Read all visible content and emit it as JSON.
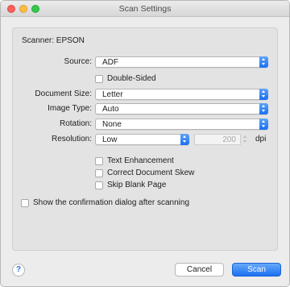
{
  "window": {
    "title": "Scan Settings"
  },
  "scanner": {
    "label": "Scanner: EPSON"
  },
  "source": {
    "label": "Source:",
    "value": "ADF"
  },
  "double_sided": {
    "label": "Double-Sided",
    "checked": false
  },
  "document_size": {
    "label": "Document Size:",
    "value": "Letter"
  },
  "image_type": {
    "label": "Image Type:",
    "value": "Auto"
  },
  "rotation": {
    "label": "Rotation:",
    "value": "None"
  },
  "resolution": {
    "label": "Resolution:",
    "value": "Low",
    "dpi_value": "200",
    "unit": "dpi"
  },
  "options": {
    "text_enhancement": {
      "label": "Text Enhancement",
      "checked": false
    },
    "correct_skew": {
      "label": "Correct Document Skew",
      "checked": false
    },
    "skip_blank": {
      "label": "Skip Blank Page",
      "checked": false
    }
  },
  "confirmation": {
    "label": "Show the confirmation dialog after scanning",
    "checked": false
  },
  "footer": {
    "help": "?",
    "cancel_label": "Cancel",
    "scan_label": "Scan"
  },
  "colors": {
    "accent": "#1d71f2",
    "background": "#ececec"
  }
}
